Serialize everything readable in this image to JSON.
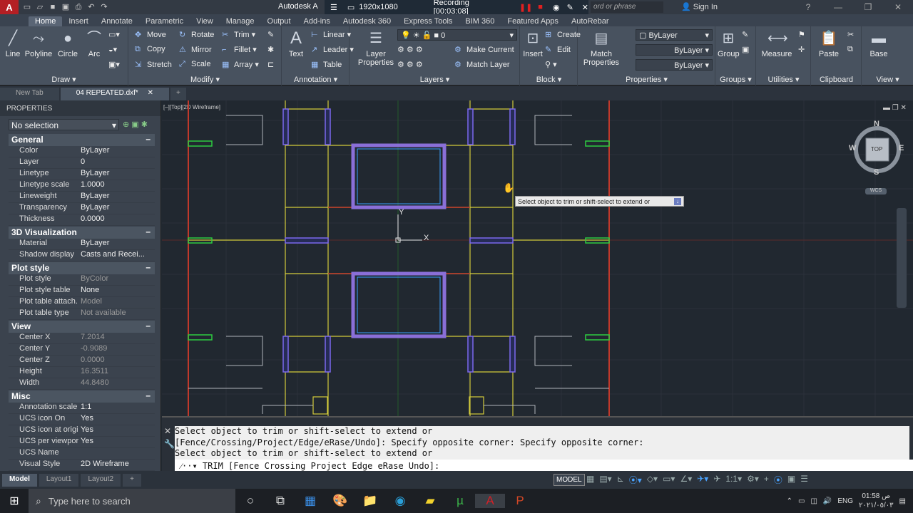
{
  "titlebar": {
    "app_title": "Autodesk A",
    "recording_resolution": "1920x1080",
    "recording_label": "Recording [00:03:08]",
    "search_placeholder": "ord or phrase",
    "signin": "Sign In"
  },
  "ribbon_tabs": [
    "Home",
    "Insert",
    "Annotate",
    "Parametric",
    "View",
    "Manage",
    "Output",
    "Add-ins",
    "Autodesk 360",
    "Express Tools",
    "BIM 360",
    "Featured Apps",
    "AutoRebar"
  ],
  "draw": {
    "title": "Draw",
    "line": "Line",
    "polyline": "Polyline",
    "circle": "Circle",
    "arc": "Arc"
  },
  "modify": {
    "title": "Modify",
    "move": "Move",
    "rotate": "Rotate",
    "trim": "Trim",
    "copy": "Copy",
    "mirror": "Mirror",
    "fillet": "Fillet",
    "stretch": "Stretch",
    "scale": "Scale",
    "array": "Array"
  },
  "annotation": {
    "title": "Annotation",
    "text": "Text",
    "linear": "Linear",
    "leader": "Leader",
    "table": "Table"
  },
  "layers": {
    "title": "Layers",
    "layer_properties": "Layer Properties",
    "current_layer": "0",
    "make_current": "Make Current",
    "match_layer": "Match Layer"
  },
  "block": {
    "title": "Block",
    "insert": "Insert",
    "create": "Create",
    "edit": "Edit"
  },
  "properties_panel": {
    "title": "Properties",
    "match": "Match Properties",
    "color": "ByLayer",
    "linetype": "ByLayer",
    "lineweight": "ByLayer"
  },
  "groups": {
    "title": "Groups",
    "group": "Group"
  },
  "utilities": {
    "title": "Utilities",
    "measure": "Measure"
  },
  "clipboard": {
    "title": "Clipboard",
    "paste": "Paste"
  },
  "view_panel": {
    "title": "View",
    "base": "Base"
  },
  "doc_tabs": {
    "new_tab": "New Tab",
    "active": "04 REPEATED.dxf*"
  },
  "props": {
    "title": "PROPERTIES",
    "selection": "No selection",
    "sections": [
      {
        "name": "General",
        "rows": [
          {
            "k": "Color",
            "v": "ByLayer"
          },
          {
            "k": "Layer",
            "v": "0"
          },
          {
            "k": "Linetype",
            "v": "ByLayer"
          },
          {
            "k": "Linetype scale",
            "v": "1.0000"
          },
          {
            "k": "Lineweight",
            "v": "ByLayer"
          },
          {
            "k": "Transparency",
            "v": "ByLayer"
          },
          {
            "k": "Thickness",
            "v": "0.0000"
          }
        ]
      },
      {
        "name": "3D Visualization",
        "rows": [
          {
            "k": "Material",
            "v": "ByLayer"
          },
          {
            "k": "Shadow display",
            "v": "Casts and Recei..."
          }
        ]
      },
      {
        "name": "Plot style",
        "rows": [
          {
            "k": "Plot style",
            "v": "ByColor"
          },
          {
            "k": "Plot style table",
            "v": "None"
          },
          {
            "k": "Plot table attach...",
            "v": "Model"
          },
          {
            "k": "Plot table type",
            "v": "Not available"
          }
        ]
      },
      {
        "name": "View",
        "rows": [
          {
            "k": "Center X",
            "v": "7.2014"
          },
          {
            "k": "Center Y",
            "v": "-0.9089"
          },
          {
            "k": "Center Z",
            "v": "0.0000"
          },
          {
            "k": "Height",
            "v": "16.3511"
          },
          {
            "k": "Width",
            "v": "44.8480"
          }
        ]
      },
      {
        "name": "Misc",
        "rows": [
          {
            "k": "Annotation scale",
            "v": "1:1"
          },
          {
            "k": "UCS icon On",
            "v": "Yes"
          },
          {
            "k": "UCS icon at origin",
            "v": "Yes"
          },
          {
            "k": "UCS per viewport",
            "v": "Yes"
          },
          {
            "k": "UCS Name",
            "v": ""
          },
          {
            "k": "Visual Style",
            "v": "2D Wireframe"
          }
        ]
      }
    ]
  },
  "viewport": {
    "label": "[–][Top][2D Wireframe]",
    "tooltip": "Select object to trim or shift-select to extend or"
  },
  "viewcube": {
    "n": "N",
    "s": "S",
    "e": "E",
    "w": "W",
    "face": "TOP",
    "wcs": "WCS"
  },
  "command": {
    "history": [
      "Select object to trim or shift-select to extend or",
      "[Fence/Crossing/Project/Edge/eRase/Undo]: Specify opposite corner: Specify opposite corner:",
      "Select object to trim or shift-select to extend or"
    ],
    "prompt": "TRIM [Fence Crossing Project Edge eRase Undo]:"
  },
  "status": {
    "model_tab": "Model",
    "layout1": "Layout1",
    "layout2": "Layout2",
    "model_btn": "MODEL",
    "scale": "1:1"
  },
  "taskbar": {
    "search": "Type here to search",
    "lang": "ENG",
    "time": "01:58 ص",
    "date": "٢٠٢١/٠٥/٠٣"
  }
}
